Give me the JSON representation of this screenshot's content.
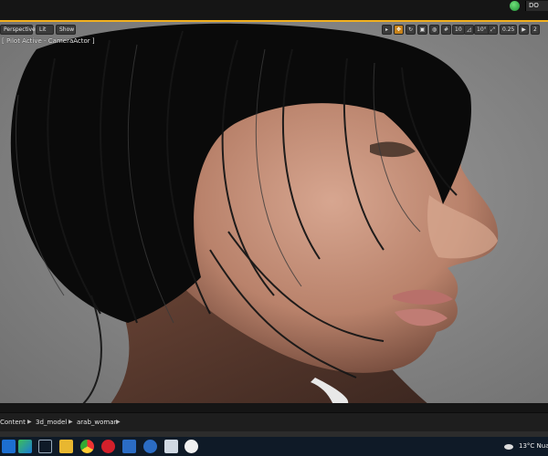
{
  "titlebar": {
    "right_label": "DO"
  },
  "viewport": {
    "perspective_label": "Perspective",
    "lit_label": "Lit",
    "show_label": "Show",
    "pilot_text": "[ Pilot Active - CameraActor ]",
    "grid_value": "10",
    "angle_value": "10°",
    "scale_value": "0.25",
    "camera_speed": "2"
  },
  "content_browser": {
    "breadcrumbs": [
      "Content",
      "3d_model",
      "arab_woman"
    ]
  },
  "taskbar": {
    "temperature": "13°C",
    "weather_text": "Nuag",
    "apps": [
      "start-icon",
      "task-view-icon",
      "file-explorer-icon",
      "chrome-icon",
      "opera-icon",
      "mail-icon",
      "maya-icon",
      "cortana-icon",
      "photos-icon",
      "unreal-engine-icon"
    ]
  },
  "colors": {
    "accent": "#f2b01e",
    "active_tool": "#c7821a",
    "taskbar": "#0f1a27"
  }
}
